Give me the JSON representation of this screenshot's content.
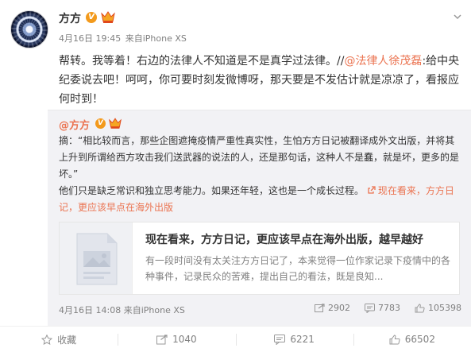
{
  "post": {
    "author": "方方",
    "verified_mark": "V",
    "meta_time": "4月16日 19:45",
    "meta_source": "来自iPhone XS",
    "text_part1": "帮转。我等着！右边的法律人不知道是不是真学过法律。//",
    "mention": "@法律人徐茂磊",
    "text_part2": ":给中央纪委说去吧！呵呵，你可要时刻发微博呀，那天要是不发估计就是凉凉了，看报应何时到！"
  },
  "repost": {
    "author": "@方方",
    "verified_mark": "V",
    "excerpt": "摘：“相比较而言，那些企图遮掩疫情严重性真实性，生怕方方日记被翻译成外文出版，并将其上升到所谓给西方攻击我们送武器的说法的人，还是那句话，这种人不是蠢，就是坏，更多的是坏。”",
    "line2_text": "他们只是缺乏常识和独立思考能力。如果还年轻，这也是一个成长过程。",
    "link_text": "现在看来，方方日记，更应该早点在海外出版",
    "preview_title": "现在看来，方方日记，更应该早点在海外出版，越早越好",
    "preview_desc": "有一段时间没有太关注方方日记了，本来觉得一位作家记录下疫情中的各种事件，记录民众的苦难，提出自己的看法，既是良知...",
    "meta_time": "4月16日 14:08",
    "meta_source": "来自iPhone XS",
    "reposts": "2902",
    "comments": "7783",
    "likes": "105398"
  },
  "footer": {
    "favorite_label": "收藏",
    "repost_count": "1040",
    "comment_count": "6221",
    "like_count": "66502"
  },
  "colors": {
    "accent": "#eb7350",
    "badge": "#f39a1c",
    "muted": "#808080"
  }
}
